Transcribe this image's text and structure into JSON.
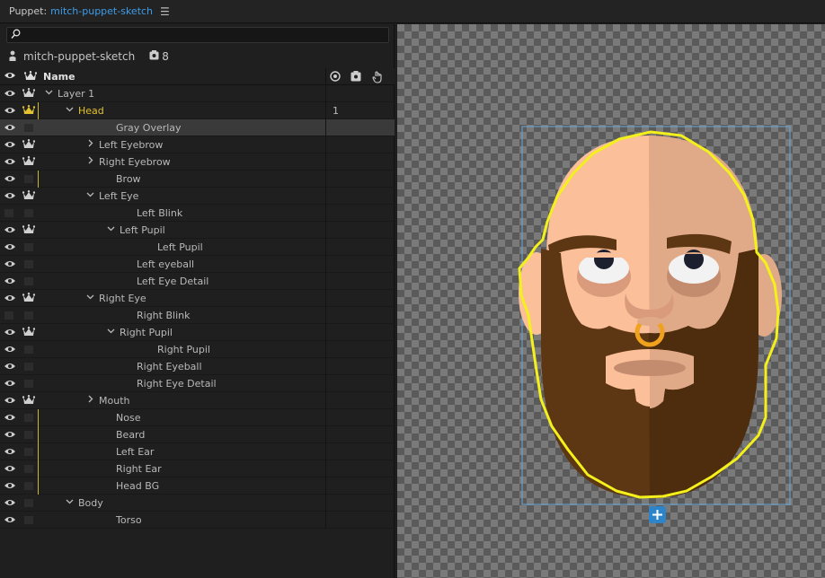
{
  "titlebar": {
    "panel_label": "Puppet:",
    "puppet_name": "mitch-puppet-sketch",
    "menu_icon": "hamburger-icon"
  },
  "search": {
    "placeholder": "",
    "icon": "search-icon"
  },
  "puppet": {
    "name": "mitch-puppet-sketch",
    "count": "8"
  },
  "header": {
    "name_label": "Name"
  },
  "colors": {
    "accent": "#3d9ce8",
    "highlight": "#e2c22e",
    "outline": "#f4f01c",
    "bbox": "#6aa8d8"
  },
  "layers": [
    {
      "name": "Layer 1",
      "indent": 0,
      "expand": "down",
      "eye": true,
      "crown": true,
      "vline": false,
      "highlight": false,
      "tag": ""
    },
    {
      "name": "Head",
      "indent": 1,
      "expand": "down",
      "eye": true,
      "crown": "yellow",
      "vline": true,
      "highlight": true,
      "tag": "1"
    },
    {
      "name": "Gray Overlay",
      "indent": 3,
      "expand": "",
      "eye": true,
      "crown": false,
      "vline": false,
      "highlight": false,
      "tag": "",
      "selected": true
    },
    {
      "name": "Left Eyebrow",
      "indent": 2,
      "expand": "right",
      "eye": true,
      "crown": true,
      "vline": false,
      "highlight": false,
      "tag": ""
    },
    {
      "name": "Right Eyebrow",
      "indent": 2,
      "expand": "right",
      "eye": true,
      "crown": true,
      "vline": false,
      "highlight": false,
      "tag": ""
    },
    {
      "name": "Brow",
      "indent": 3,
      "expand": "",
      "eye": true,
      "crown": false,
      "vline": true,
      "highlight": false,
      "tag": ""
    },
    {
      "name": "Left Eye",
      "indent": 2,
      "expand": "down",
      "eye": true,
      "crown": true,
      "vline": false,
      "highlight": false,
      "tag": ""
    },
    {
      "name": "Left Blink",
      "indent": 4,
      "expand": "",
      "eye": false,
      "crown": false,
      "vline": false,
      "highlight": false,
      "tag": ""
    },
    {
      "name": "Left Pupil",
      "indent": 3,
      "expand": "down",
      "eye": true,
      "crown": true,
      "vline": false,
      "highlight": false,
      "tag": ""
    },
    {
      "name": "Left Pupil",
      "indent": 5,
      "expand": "",
      "eye": true,
      "crown": false,
      "vline": false,
      "highlight": false,
      "tag": ""
    },
    {
      "name": "Left eyeball",
      "indent": 4,
      "expand": "",
      "eye": true,
      "crown": false,
      "vline": false,
      "highlight": false,
      "tag": ""
    },
    {
      "name": "Left Eye Detail",
      "indent": 4,
      "expand": "",
      "eye": true,
      "crown": false,
      "vline": false,
      "highlight": false,
      "tag": ""
    },
    {
      "name": "Right Eye",
      "indent": 2,
      "expand": "down",
      "eye": true,
      "crown": true,
      "vline": false,
      "highlight": false,
      "tag": ""
    },
    {
      "name": "Right Blink",
      "indent": 4,
      "expand": "",
      "eye": false,
      "crown": false,
      "vline": false,
      "highlight": false,
      "tag": ""
    },
    {
      "name": "Right Pupil",
      "indent": 3,
      "expand": "down",
      "eye": true,
      "crown": true,
      "vline": false,
      "highlight": false,
      "tag": ""
    },
    {
      "name": "Right Pupil",
      "indent": 5,
      "expand": "",
      "eye": true,
      "crown": false,
      "vline": false,
      "highlight": false,
      "tag": ""
    },
    {
      "name": "Right Eyeball",
      "indent": 4,
      "expand": "",
      "eye": true,
      "crown": false,
      "vline": false,
      "highlight": false,
      "tag": ""
    },
    {
      "name": "Right Eye Detail",
      "indent": 4,
      "expand": "",
      "eye": true,
      "crown": false,
      "vline": false,
      "highlight": false,
      "tag": ""
    },
    {
      "name": "Mouth",
      "indent": 2,
      "expand": "right",
      "eye": true,
      "crown": true,
      "vline": false,
      "highlight": false,
      "tag": ""
    },
    {
      "name": "Nose",
      "indent": 3,
      "expand": "",
      "eye": true,
      "crown": false,
      "vline": true,
      "highlight": false,
      "tag": ""
    },
    {
      "name": "Beard",
      "indent": 3,
      "expand": "",
      "eye": true,
      "crown": false,
      "vline": true,
      "highlight": false,
      "tag": ""
    },
    {
      "name": "Left Ear",
      "indent": 3,
      "expand": "",
      "eye": true,
      "crown": false,
      "vline": true,
      "highlight": false,
      "tag": ""
    },
    {
      "name": "Right Ear",
      "indent": 3,
      "expand": "",
      "eye": true,
      "crown": false,
      "vline": true,
      "highlight": false,
      "tag": ""
    },
    {
      "name": "Head BG",
      "indent": 3,
      "expand": "",
      "eye": true,
      "crown": false,
      "vline": true,
      "highlight": false,
      "tag": ""
    },
    {
      "name": "Body",
      "indent": 1,
      "expand": "down",
      "eye": true,
      "crown": false,
      "vline": false,
      "highlight": false,
      "tag": ""
    },
    {
      "name": "Torso",
      "indent": 3,
      "expand": "",
      "eye": true,
      "crown": false,
      "vline": false,
      "highlight": false,
      "tag": ""
    }
  ]
}
